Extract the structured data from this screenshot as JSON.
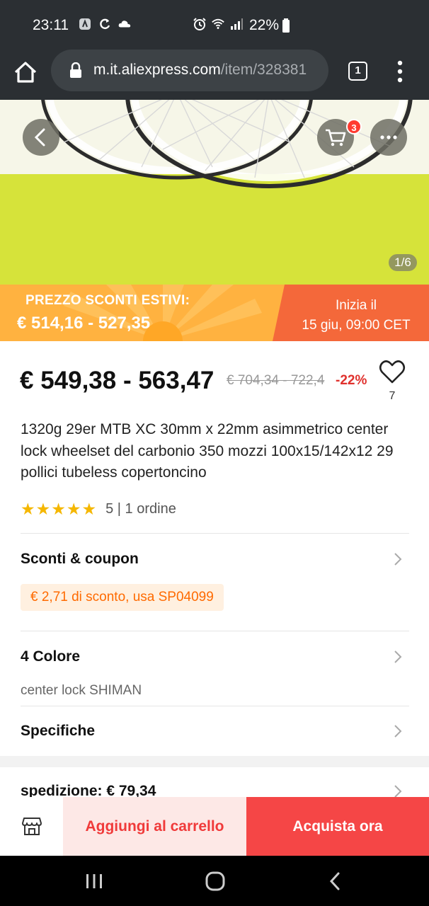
{
  "status_bar": {
    "time": "23:11",
    "battery": "22%",
    "icons": [
      "app-icon",
      "sync-icon",
      "cloud-icon",
      "alarm-icon",
      "wifi-icon",
      "signal-icon",
      "battery-icon"
    ]
  },
  "browser": {
    "url_host": "m.it.aliexpress.com",
    "url_path": "/item/328381",
    "tab_count": "1"
  },
  "hero": {
    "cart_count": "3",
    "image_counter": "1/6"
  },
  "promo": {
    "title": "PREZZO SCONTI ESTIVI:",
    "price": "€ 514,16 - 527,35",
    "starts_label": "Inizia il",
    "starts_date": "15 giu, 09:00 CET"
  },
  "product": {
    "price": "€ 549,38 - 563,47",
    "old_price": "€ 704,34 - 722,4",
    "discount": "-22%",
    "wishlist_count": "7",
    "title": "1320g 29er MTB XC 30mm x 22mm asimmetrico center lock wheelset del carbonio 350 mozzi 100x15/142x12 29 pollici tubeless copertoncino",
    "rating_stars": "★★★★★",
    "rating_text": "5 | 1 ordine"
  },
  "sections": {
    "coupons_label": "Sconti & coupon",
    "coupon_text": "€ 2,71 di sconto, usa SP04099",
    "color_label": "4 Colore",
    "color_value": "center lock SHIMAN",
    "specs_label": "Specifiche",
    "shipping_label": "spedizione: € 79,34"
  },
  "actions": {
    "add_to_cart": "Aggiungi al carrello",
    "buy_now": "Acquista ora"
  },
  "colors": {
    "accent_red": "#f54646",
    "promo_orange": "#ffb240",
    "promo_red": "#f4683a",
    "coupon_orange": "#ff6a00"
  }
}
